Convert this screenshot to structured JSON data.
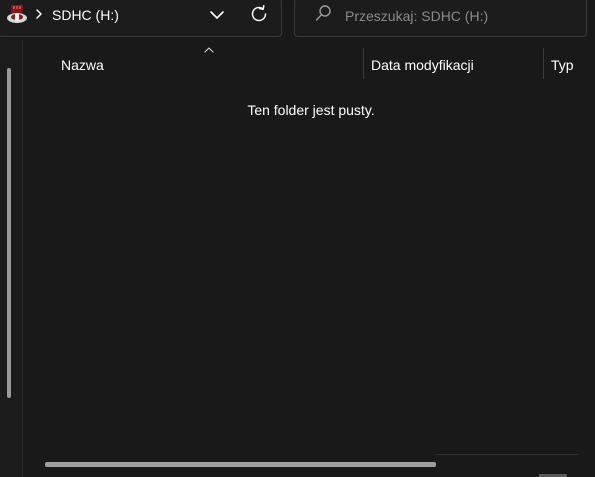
{
  "address_bar": {
    "drive_icon": "removable-drive-icon",
    "separator_icon": "chevron-right-icon",
    "location_label": "SDHC (H:)",
    "dropdown_icon": "chevron-down-icon",
    "refresh_icon": "refresh-icon"
  },
  "search": {
    "icon": "search-icon",
    "placeholder": "Przeszukaj: SDHC (H:)",
    "value": ""
  },
  "file_list": {
    "sort_indicator": "sort-ascending-icon",
    "columns": [
      {
        "label": "Nazwa",
        "sorted": true
      },
      {
        "label": "Data modyfikacji",
        "sorted": false
      },
      {
        "label": "Typ",
        "sorted": false
      }
    ],
    "empty_message": "Ten folder jest pusty."
  },
  "colors": {
    "background": "#191919",
    "border": "#3a3a3a",
    "text": "#ffffff",
    "placeholder": "#8a8a8a",
    "scrollbar": "#9e9e9e"
  }
}
